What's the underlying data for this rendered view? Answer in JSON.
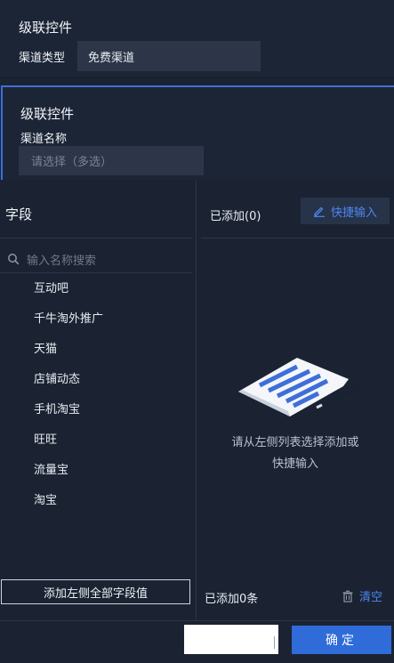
{
  "section1": {
    "title": "级联控件",
    "label": "渠道类型",
    "value": "免费渠道"
  },
  "section2": {
    "title": "级联控件",
    "label": "渠道名称",
    "placeholder": "请选择（多选）"
  },
  "left_panel": {
    "header": "字段",
    "search_placeholder": "输入名称搜索",
    "items": [
      "互动吧",
      "千牛淘外推广",
      "天猫",
      "店铺动态",
      "手机淘宝",
      "旺旺",
      "流量宝",
      "淘宝"
    ],
    "add_all_label": "添加左侧全部字段值"
  },
  "right_panel": {
    "added_label": "已添加(0)",
    "quick_input_label": "快捷输入",
    "empty_text_line1": "请从左侧列表选择添加或",
    "empty_text_line2": "快捷输入",
    "bottom_count": "已添加0条",
    "clear_label": "清空"
  },
  "footer": {
    "confirm_label": "确定"
  },
  "colors": {
    "background": "#1b2333",
    "accent_blue": "#2f6bd9",
    "link_blue": "#4d86f1",
    "input_bg": "#2c3648"
  },
  "icons": {
    "search": "search-icon",
    "edit": "edit-icon",
    "trash": "trash-icon",
    "empty": "empty-document-illustration"
  }
}
